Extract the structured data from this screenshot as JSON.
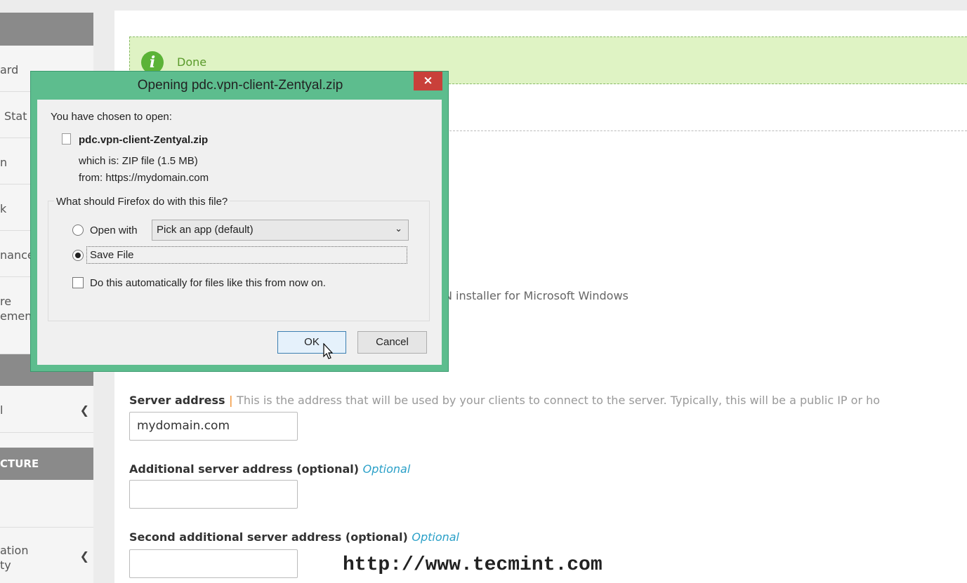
{
  "sidebar": {
    "items": [
      {
        "label": "ard"
      },
      {
        "label": "Stat"
      },
      {
        "label": "n"
      },
      {
        "label": "k"
      },
      {
        "label": "nance"
      },
      {
        "label": "re\nemen"
      },
      {
        "label": "l"
      },
      {
        "label": "ation\nty"
      }
    ],
    "section_header": "CTURE"
  },
  "banner": {
    "text": "Done",
    "icon": "info-icon"
  },
  "page": {
    "installer_text": "N installer for Microsoft Windows",
    "server_address": {
      "label": "Server address",
      "separator": "|",
      "hint": "This is the address that will be used by your clients to connect to the server. Typically, this will be a public IP or ho",
      "value": "mydomain.com"
    },
    "additional": {
      "label": "Additional server address (optional)",
      "optional": "Optional",
      "value": ""
    },
    "second_additional": {
      "label": "Second additional server address (optional)",
      "optional": "Optional",
      "value": ""
    }
  },
  "watermark": "http://www.tecmint.com",
  "dialog": {
    "title": "Opening pdc.vpn-client-Zentyal.zip",
    "close": "×",
    "chosen_label": "You have chosen to open:",
    "filename": "pdc.vpn-client-Zentyal.zip",
    "which_is_label": "which is:",
    "which_is": "ZIP file (1.5 MB)",
    "from_label": "from:",
    "from": "https://mydomain.com",
    "question": "What should Firefox do with this file?",
    "open_with": "Open with",
    "open_with_app": "Pick an app (default)",
    "save_file": "Save File",
    "auto": "Do this automatically for files like this from now on.",
    "ok": "OK",
    "cancel": "Cancel"
  },
  "colors": {
    "dialog_frame": "#5dbd8e",
    "banner_bg": "#dff3c4",
    "optional": "#2aa0c8"
  }
}
